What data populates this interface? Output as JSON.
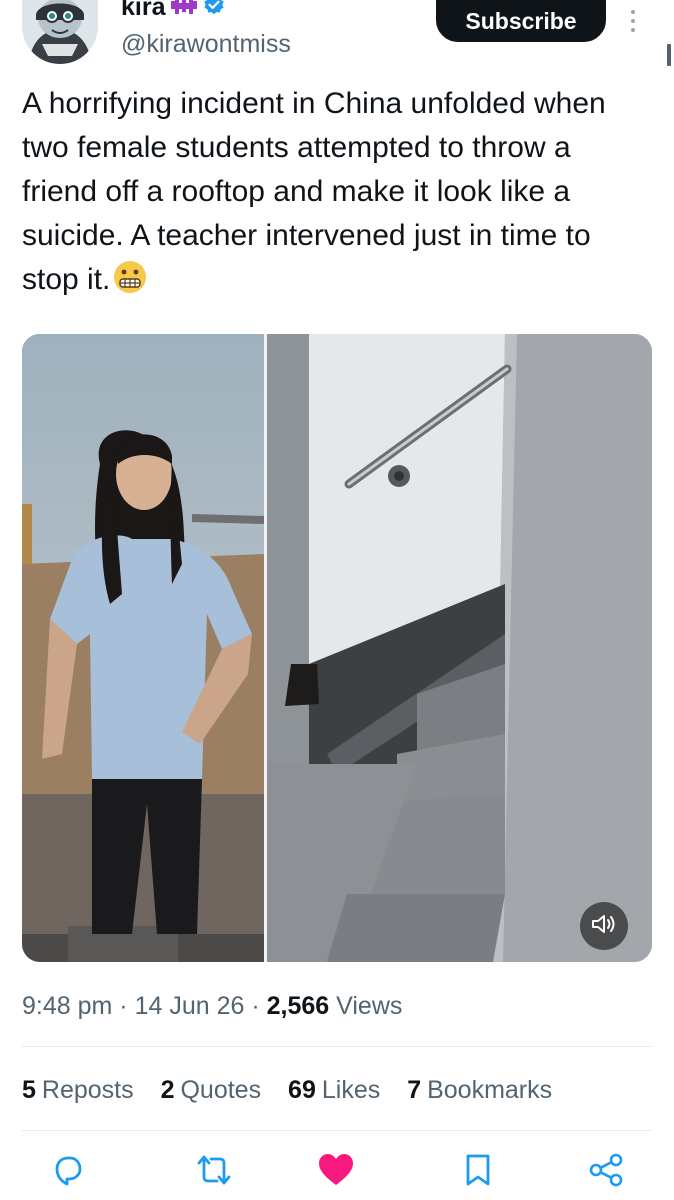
{
  "author": {
    "display_name": "kira",
    "handle": "@kirawontmiss",
    "verified": true,
    "emoji_badge": "purple-space-invader-emoji",
    "avatar_icon": "cartoon-avatar"
  },
  "header": {
    "subscribe_label": "Subscribe",
    "more_icon": "vertical-ellipsis-icon"
  },
  "tweet": {
    "text": "A horrifying incident in China unfolded when two female students attempted to throw a friend off a rooftop and make it look like a suicide. A teacher intervened just in time to stop it.",
    "emoji": "grimacing-face-emoji"
  },
  "media": {
    "type": "video",
    "left_panel": "photo of a student on a rooftop",
    "right_panel": "stairwell with handrail",
    "volume_icon": "speaker-icon"
  },
  "meta": {
    "time": "9:48 pm",
    "separator": "·",
    "date": "14 Jun 26",
    "views_count": "2,566",
    "views_label": "Views"
  },
  "stats": {
    "reposts_count": "5",
    "reposts_label": "Reposts",
    "quotes_count": "2",
    "quotes_label": "Quotes",
    "likes_count": "69",
    "likes_label": "Likes",
    "bookmarks_count": "7",
    "bookmarks_label": "Bookmarks"
  },
  "actions": {
    "reply_icon": "reply-icon",
    "repost_icon": "repost-icon",
    "like_icon": "heart-icon",
    "bookmark_icon": "bookmark-icon",
    "share_icon": "share-icon"
  },
  "colors": {
    "text_primary": "#0f1419",
    "text_secondary": "#536471",
    "verified_blue": "#1d9bf0",
    "like_pink": "#f91880",
    "badge_purple": "#a03ac8"
  }
}
